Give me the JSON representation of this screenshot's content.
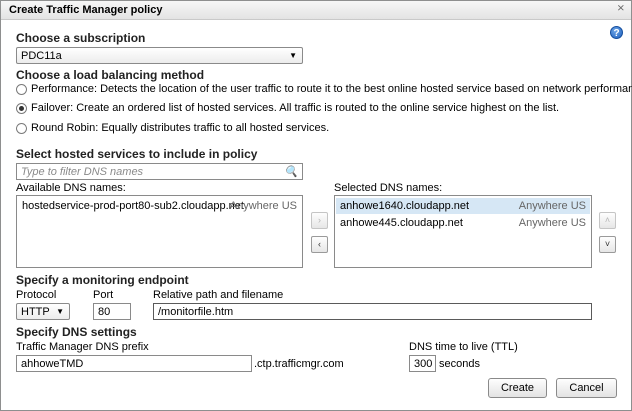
{
  "window": {
    "title": "Create Traffic Manager policy",
    "close_glyph": "⨯"
  },
  "subscription": {
    "heading": "Choose a subscription",
    "selected": "PDC11a"
  },
  "method": {
    "heading": "Choose a load balancing method",
    "options": [
      {
        "label": "Performance: Detects the location of the user traffic to route it to the best online hosted service based on network performance.",
        "selected": false
      },
      {
        "label": "Failover: Create an ordered list of hosted services. All traffic is routed to the online service highest on the list.",
        "selected": true
      },
      {
        "label": "Round Robin: Equally distributes traffic to all hosted services.",
        "selected": false
      }
    ]
  },
  "hosted": {
    "heading": "Select hosted services to include in policy",
    "filter_placeholder": "Type to filter DNS names",
    "available_label": "Available DNS names:",
    "available": [
      {
        "name": "hostedservice-prod-port80-sub2.cloudapp.net",
        "region": "Anywhere US"
      }
    ],
    "selected_label": "Selected DNS names:",
    "selected": [
      {
        "name": "anhowe1640.cloudapp.net",
        "region": "Anywhere US",
        "highlighted": true
      },
      {
        "name": "anhowe445.cloudapp.net",
        "region": "Anywhere US",
        "highlighted": false
      }
    ],
    "move_right_glyph": "›",
    "move_left_glyph": "‹",
    "move_up_glyph": "˄",
    "move_down_glyph": "˅"
  },
  "monitoring": {
    "heading": "Specify a monitoring endpoint",
    "protocol_label": "Protocol",
    "protocol_value": "HTTP",
    "port_label": "Port",
    "port_value": "80",
    "path_label": "Relative path and filename",
    "path_value": "/monitorfile.htm"
  },
  "dns": {
    "heading": "Specify DNS settings",
    "prefix_label": "Traffic Manager DNS prefix",
    "prefix_value": "ahhoweTMD",
    "suffix": ".ctp.trafficmgr.com",
    "ttl_label": "DNS time to live (TTL)",
    "ttl_value": "300",
    "ttl_unit": "seconds"
  },
  "actions": {
    "create": "Create",
    "cancel": "Cancel"
  },
  "colors": {
    "selected_row": "#d6e7f5",
    "help_icon": "#1c5fbf"
  }
}
